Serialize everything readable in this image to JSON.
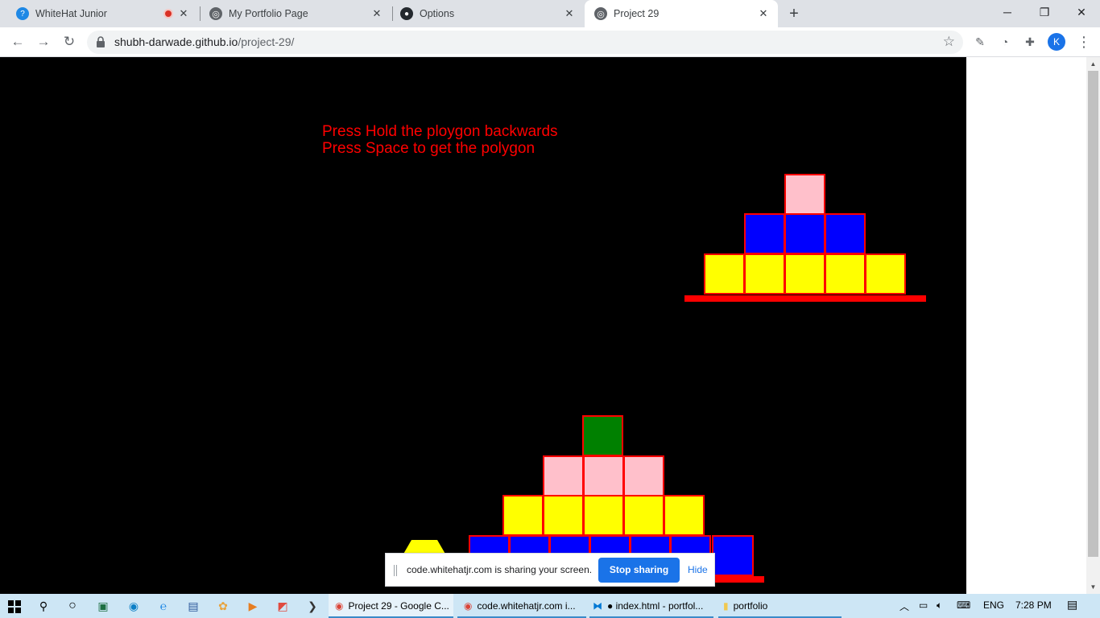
{
  "browser": {
    "tabs": [
      {
        "title": "WhiteHat Junior",
        "icon": "whitehat-icon",
        "recording": true
      },
      {
        "title": "My Portfolio Page",
        "icon": "globe-icon"
      },
      {
        "title": "Options",
        "icon": "github-icon"
      },
      {
        "title": "Project 29",
        "icon": "globe-icon",
        "active": true
      }
    ],
    "url_host": "shubh-darwade.github.io",
    "url_path": "/project-29/",
    "avatar_letter": "K"
  },
  "game": {
    "instruction_line_1": "Press Hold the ploygon backwards",
    "instruction_line_2": "Press Space to get the polygon",
    "colors": {
      "background": "#000000",
      "outline": "#ff0000",
      "pink": "#ffc0cb",
      "blue": "#0000ff",
      "yellow": "#ffff00",
      "green": "#008000"
    }
  },
  "share_banner": {
    "message": "code.whitehatjr.com is sharing your screen.",
    "stop_label": "Stop sharing",
    "hide_label": "Hide"
  },
  "taskbar": {
    "apps": [
      {
        "label": "Project 29 - Google C...",
        "icon": "chrome-icon",
        "active": true
      },
      {
        "label": "code.whitehatjr.com i...",
        "icon": "chrome-icon"
      },
      {
        "label": "● index.html - portfol...",
        "icon": "vscode-icon"
      },
      {
        "label": "portfolio",
        "icon": "folder-icon"
      }
    ],
    "language": "ENG",
    "time": "7:28 PM"
  }
}
